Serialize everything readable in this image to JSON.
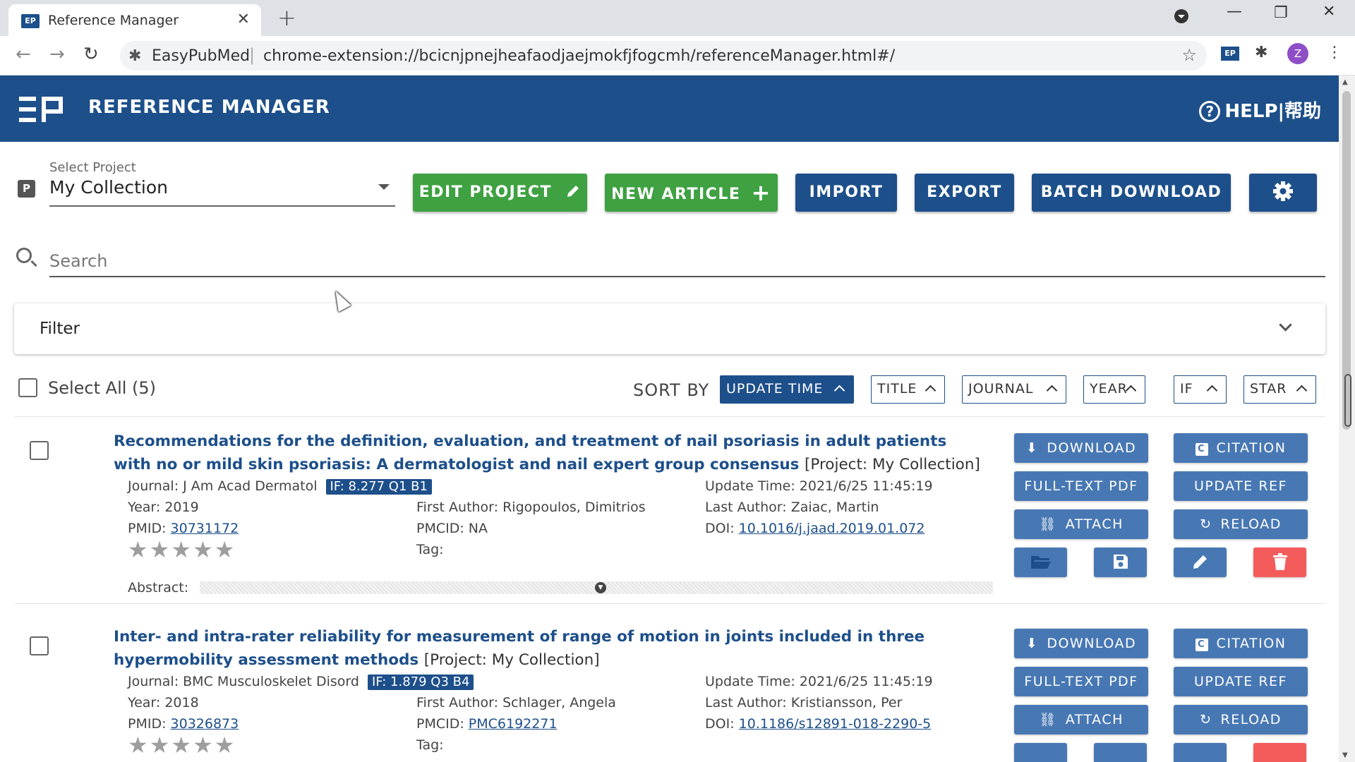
{
  "browser": {
    "tab_title": "Reference Manager",
    "tab_close": "✕",
    "new_tab": "+",
    "site_name": "EasyPubMed",
    "url": "chrome-extension://bcicnjpnejheafaodjaejmokfjfogcmh/referenceManager.html#/",
    "avatar_letter": "Z"
  },
  "header": {
    "title": "REFERENCE MANAGER",
    "help": "HELP|帮助"
  },
  "project": {
    "label": "Select Project",
    "icon_letter": "P",
    "selected": "My Collection"
  },
  "toolbar": {
    "edit_project": "EDIT PROJECT",
    "new_article": "NEW ARTICLE",
    "import": "IMPORT",
    "export": "EXPORT",
    "batch_download": "BATCH DOWNLOAD"
  },
  "search": {
    "placeholder": "Search"
  },
  "filter": {
    "label": "Filter"
  },
  "list": {
    "select_all": "Select All (5)",
    "sort_by": "SORT BY",
    "sort_options": [
      "UPDATE TIME",
      "TITLE",
      "JOURNAL",
      "YEAR",
      "IF",
      "STAR"
    ],
    "active_sort": "UPDATE TIME"
  },
  "article_buttons": {
    "download": "DOWNLOAD",
    "citation": "CITATION",
    "fulltext": "FULL-TEXT PDF",
    "update_ref": "UPDATE REF",
    "attach": "ATTACH",
    "reload": "RELOAD"
  },
  "articles": [
    {
      "title": "Recommendations for the definition, evaluation, and treatment of nail psoriasis in adult patients with no or mild skin psoriasis: A dermatologist and nail expert group consensus",
      "project": "[Project: My Collection]",
      "journal": "Journal: J Am Acad Dermatol",
      "if_badge": "IF: 8.277 Q1 B1",
      "update_time": "Update Time: 2021/6/25 11:45:19",
      "year": "Year: 2019",
      "first_author": "First Author: Rigopoulos, Dimitrios",
      "last_author": "Last Author: Zaiac, Martin",
      "pmid_label": "PMID: ",
      "pmid": "30731172",
      "pmcid_label": "PMCID: ",
      "pmcid": "NA",
      "doi_label": "DOI: ",
      "doi": "10.1016/j.jaad.2019.01.072",
      "tag": "Tag:",
      "stars": "★★★★★",
      "abstract_label": "Abstract:"
    },
    {
      "title": "Inter- and intra-rater reliability for measurement of range of motion in joints included in three hypermobility assessment methods",
      "project": "[Project: My Collection]",
      "journal": "Journal: BMC Musculoskelet Disord",
      "if_badge": "IF: 1.879 Q3 B4",
      "update_time": "Update Time: 2021/6/25 11:45:19",
      "year": "Year: 2018",
      "first_author": "First Author: Schlager, Angela",
      "last_author": "Last Author: Kristiansson, Per",
      "pmid_label": "PMID: ",
      "pmid": "30326873",
      "pmcid_label": "PMCID: ",
      "pmcid": "PMC6192271",
      "doi_label": "DOI: ",
      "doi": "10.1186/s12891-018-2290-5",
      "tag": "Tag:",
      "stars": "★★★★★"
    }
  ],
  "colors": {
    "brand_blue": "#1d4f8a",
    "action_blue": "#4878b4",
    "green": "#3fa142",
    "danger": "#f45b5b"
  },
  "icons": [
    "pencil-icon",
    "plus-icon",
    "gear-icon",
    "search-icon",
    "chevron-down-icon",
    "download-icon",
    "citation-icon",
    "link-icon",
    "reload-icon",
    "folder-icon",
    "save-icon",
    "edit-icon",
    "trash-icon"
  ]
}
